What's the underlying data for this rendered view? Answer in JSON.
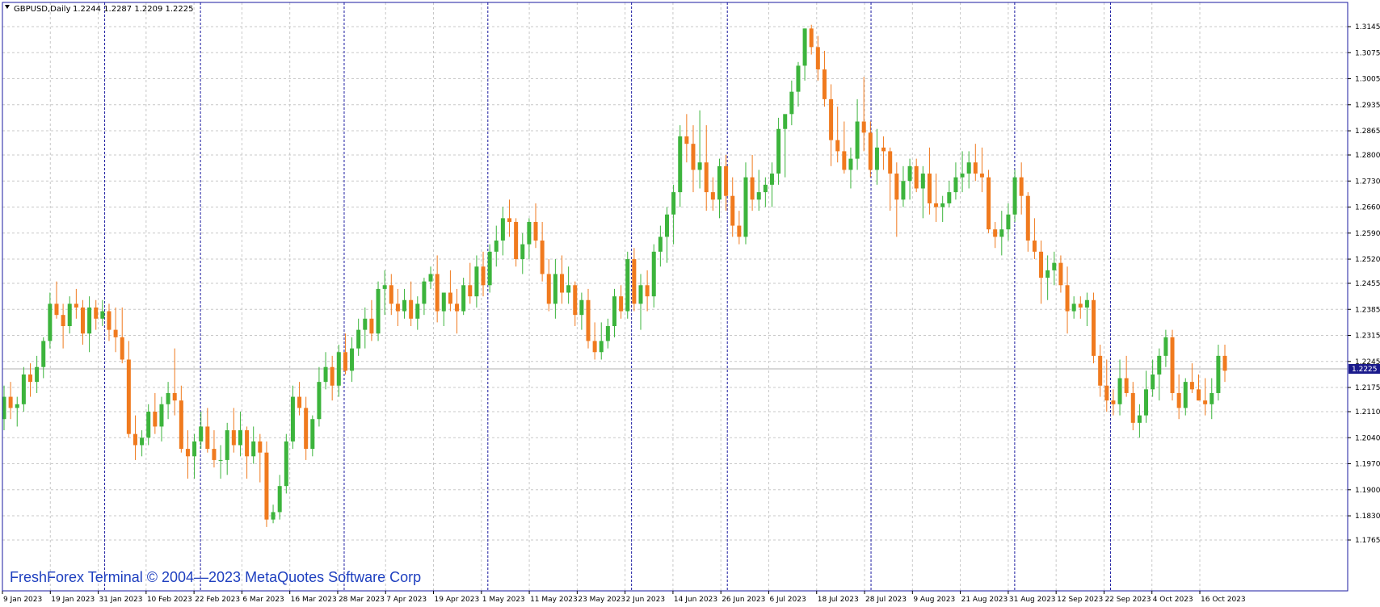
{
  "header": {
    "title": "GBPUSD,Daily",
    "ohlc": "1.2244 1.2287 1.2209 1.2225"
  },
  "watermark": "FreshForex Terminal © 2004—2023 MetaQuotes Software Corp",
  "colors": {
    "bull": "#3cb43c",
    "bear": "#f07a1e",
    "frame": "#1a1aa0",
    "grid": "#c8c8c8",
    "period_sep": "#1a1aa0",
    "current_price_bg": "#1a1a8c"
  },
  "current_price": "1.2225",
  "chart_data": {
    "type": "candlestick",
    "title": "GBPUSD,Daily",
    "ylim": [
      1.1765,
      1.3145
    ],
    "y_ticks": [
      "1.3145",
      "1.3075",
      "1.3005",
      "1.2935",
      "1.2865",
      "1.2800",
      "1.2730",
      "1.2660",
      "1.2590",
      "1.2520",
      "1.2455",
      "1.2385",
      "1.2315",
      "1.2245",
      "1.2175",
      "1.2110",
      "1.2040",
      "1.1970",
      "1.1900",
      "1.1830",
      "1.1765"
    ],
    "x_labels": [
      "9 Jan 2023",
      "19 Jan 2023",
      "31 Jan 2023",
      "10 Feb 2023",
      "22 Feb 2023",
      "6 Mar 2023",
      "16 Mar 2023",
      "28 Mar 2023",
      "7 Apr 2023",
      "19 Apr 2023",
      "1 May 2023",
      "11 May 2023",
      "23 May 2023",
      "2 Jun 2023",
      "14 Jun 2023",
      "26 Jun 2023",
      "6 Jul 2023",
      "18 Jul 2023",
      "28 Jul 2023",
      "9 Aug 2023",
      "21 Aug 2023",
      "31 Aug 2023",
      "12 Sep 2023",
      "22 Sep 2023",
      "4 Oct 2023",
      "16 Oct 2023"
    ],
    "grid": true,
    "candles": [
      [
        1.209,
        1.218,
        1.206,
        1.215
      ],
      [
        1.215,
        1.219,
        1.209,
        1.212
      ],
      [
        1.212,
        1.215,
        1.207,
        1.213
      ],
      [
        1.213,
        1.223,
        1.211,
        1.221
      ],
      [
        1.221,
        1.224,
        1.215,
        1.219
      ],
      [
        1.219,
        1.226,
        1.216,
        1.223
      ],
      [
        1.223,
        1.231,
        1.22,
        1.23
      ],
      [
        1.23,
        1.243,
        1.228,
        1.24
      ],
      [
        1.24,
        1.246,
        1.236,
        1.237
      ],
      [
        1.237,
        1.24,
        1.228,
        1.234
      ],
      [
        1.234,
        1.242,
        1.232,
        1.24
      ],
      [
        1.24,
        1.244,
        1.236,
        1.239
      ],
      [
        1.239,
        1.241,
        1.229,
        1.232
      ],
      [
        1.232,
        1.242,
        1.227,
        1.239
      ],
      [
        1.239,
        1.241,
        1.233,
        1.236
      ],
      [
        1.236,
        1.241,
        1.234,
        1.238
      ],
      [
        1.238,
        1.24,
        1.23,
        1.233
      ],
      [
        1.233,
        1.239,
        1.227,
        1.231
      ],
      [
        1.231,
        1.239,
        1.224,
        1.225
      ],
      [
        1.225,
        1.23,
        1.204,
        1.205
      ],
      [
        1.205,
        1.21,
        1.198,
        1.202
      ],
      [
        1.202,
        1.206,
        1.199,
        1.204
      ],
      [
        1.204,
        1.213,
        1.202,
        1.211
      ],
      [
        1.211,
        1.216,
        1.205,
        1.207
      ],
      [
        1.207,
        1.215,
        1.203,
        1.213
      ],
      [
        1.213,
        1.219,
        1.209,
        1.216
      ],
      [
        1.216,
        1.228,
        1.21,
        1.214
      ],
      [
        1.214,
        1.218,
        1.2,
        1.201
      ],
      [
        1.201,
        1.206,
        1.193,
        1.199
      ],
      [
        1.199,
        1.205,
        1.193,
        1.203
      ],
      [
        1.203,
        1.211,
        1.201,
        1.207
      ],
      [
        1.207,
        1.212,
        1.2,
        1.201
      ],
      [
        1.201,
        1.206,
        1.196,
        1.198
      ],
      [
        1.198,
        1.202,
        1.193,
        1.198
      ],
      [
        1.198,
        1.208,
        1.194,
        1.206
      ],
      [
        1.206,
        1.212,
        1.2,
        1.202
      ],
      [
        1.202,
        1.211,
        1.199,
        1.206
      ],
      [
        1.206,
        1.207,
        1.193,
        1.199
      ],
      [
        1.199,
        1.207,
        1.197,
        1.203
      ],
      [
        1.203,
        1.205,
        1.192,
        1.2
      ],
      [
        1.2,
        1.203,
        1.18,
        1.182
      ],
      [
        1.182,
        1.186,
        1.181,
        1.184
      ],
      [
        1.184,
        1.194,
        1.182,
        1.191
      ],
      [
        1.191,
        1.205,
        1.189,
        1.203
      ],
      [
        1.203,
        1.218,
        1.201,
        1.215
      ],
      [
        1.215,
        1.219,
        1.21,
        1.212
      ],
      [
        1.212,
        1.215,
        1.198,
        1.201
      ],
      [
        1.201,
        1.21,
        1.199,
        1.209
      ],
      [
        1.209,
        1.223,
        1.207,
        1.219
      ],
      [
        1.219,
        1.227,
        1.217,
        1.223
      ],
      [
        1.223,
        1.226,
        1.214,
        1.218
      ],
      [
        1.218,
        1.229,
        1.215,
        1.227
      ],
      [
        1.227,
        1.232,
        1.221,
        1.222
      ],
      [
        1.222,
        1.231,
        1.219,
        1.228
      ],
      [
        1.228,
        1.236,
        1.226,
        1.233
      ],
      [
        1.233,
        1.239,
        1.228,
        1.236
      ],
      [
        1.236,
        1.241,
        1.23,
        1.232
      ],
      [
        1.232,
        1.246,
        1.23,
        1.244
      ],
      [
        1.244,
        1.249,
        1.237,
        1.245
      ],
      [
        1.245,
        1.248,
        1.237,
        1.24
      ],
      [
        1.24,
        1.244,
        1.234,
        1.238
      ],
      [
        1.238,
        1.244,
        1.236,
        1.241
      ],
      [
        1.241,
        1.246,
        1.234,
        1.236
      ],
      [
        1.236,
        1.242,
        1.233,
        1.24
      ],
      [
        1.24,
        1.247,
        1.237,
        1.246
      ],
      [
        1.246,
        1.25,
        1.244,
        1.248
      ],
      [
        1.248,
        1.253,
        1.235,
        1.238
      ],
      [
        1.238,
        1.243,
        1.234,
        1.243
      ],
      [
        1.243,
        1.249,
        1.238,
        1.24
      ],
      [
        1.24,
        1.244,
        1.232,
        1.238
      ],
      [
        1.238,
        1.247,
        1.237,
        1.245
      ],
      [
        1.245,
        1.251,
        1.24,
        1.242
      ],
      [
        1.242,
        1.253,
        1.239,
        1.25
      ],
      [
        1.25,
        1.254,
        1.242,
        1.245
      ],
      [
        1.245,
        1.256,
        1.243,
        1.254
      ],
      [
        1.254,
        1.261,
        1.25,
        1.257
      ],
      [
        1.257,
        1.266,
        1.253,
        1.263
      ],
      [
        1.263,
        1.268,
        1.258,
        1.262
      ],
      [
        1.262,
        1.263,
        1.25,
        1.252
      ],
      [
        1.252,
        1.259,
        1.248,
        1.256
      ],
      [
        1.256,
        1.263,
        1.252,
        1.262
      ],
      [
        1.262,
        1.267,
        1.255,
        1.257
      ],
      [
        1.257,
        1.262,
        1.246,
        1.248
      ],
      [
        1.248,
        1.252,
        1.238,
        1.24
      ],
      [
        1.24,
        1.252,
        1.236,
        1.248
      ],
      [
        1.248,
        1.253,
        1.24,
        1.243
      ],
      [
        1.243,
        1.25,
        1.24,
        1.245
      ],
      [
        1.245,
        1.246,
        1.234,
        1.237
      ],
      [
        1.237,
        1.243,
        1.233,
        1.241
      ],
      [
        1.241,
        1.244,
        1.228,
        1.23
      ],
      [
        1.23,
        1.235,
        1.225,
        1.227
      ],
      [
        1.227,
        1.235,
        1.225,
        1.23
      ],
      [
        1.23,
        1.236,
        1.228,
        1.234
      ],
      [
        1.234,
        1.244,
        1.231,
        1.242
      ],
      [
        1.242,
        1.245,
        1.236,
        1.238
      ],
      [
        1.238,
        1.254,
        1.236,
        1.252
      ],
      [
        1.252,
        1.255,
        1.238,
        1.24
      ],
      [
        1.24,
        1.248,
        1.233,
        1.245
      ],
      [
        1.245,
        1.249,
        1.238,
        1.242
      ],
      [
        1.242,
        1.256,
        1.239,
        1.254
      ],
      [
        1.254,
        1.261,
        1.25,
        1.258
      ],
      [
        1.258,
        1.266,
        1.251,
        1.264
      ],
      [
        1.264,
        1.272,
        1.256,
        1.27
      ],
      [
        1.27,
        1.288,
        1.266,
        1.285
      ],
      [
        1.285,
        1.291,
        1.278,
        1.283
      ],
      [
        1.283,
        1.288,
        1.27,
        1.276
      ],
      [
        1.276,
        1.292,
        1.271,
        1.278
      ],
      [
        1.278,
        1.288,
        1.265,
        1.27
      ],
      [
        1.27,
        1.274,
        1.265,
        1.268
      ],
      [
        1.268,
        1.279,
        1.263,
        1.277
      ],
      [
        1.277,
        1.28,
        1.265,
        1.269
      ],
      [
        1.269,
        1.274,
        1.258,
        1.261
      ],
      [
        1.261,
        1.265,
        1.256,
        1.258
      ],
      [
        1.258,
        1.278,
        1.256,
        1.274
      ],
      [
        1.274,
        1.28,
        1.265,
        1.268
      ],
      [
        1.268,
        1.276,
        1.265,
        1.27
      ],
      [
        1.27,
        1.274,
        1.266,
        1.272
      ],
      [
        1.272,
        1.278,
        1.266,
        1.275
      ],
      [
        1.275,
        1.29,
        1.272,
        1.287
      ],
      [
        1.287,
        1.29,
        1.274,
        1.291
      ],
      [
        1.291,
        1.3,
        1.288,
        1.297
      ],
      [
        1.297,
        1.305,
        1.293,
        1.304
      ],
      [
        1.304,
        1.314,
        1.3,
        1.314
      ],
      [
        1.314,
        1.315,
        1.307,
        1.309
      ],
      [
        1.309,
        1.312,
        1.3,
        1.303
      ],
      [
        1.303,
        1.308,
        1.293,
        1.295
      ],
      [
        1.295,
        1.299,
        1.277,
        1.284
      ],
      [
        1.284,
        1.293,
        1.278,
        1.281
      ],
      [
        1.281,
        1.289,
        1.275,
        1.276
      ],
      [
        1.276,
        1.282,
        1.271,
        1.279
      ],
      [
        1.279,
        1.295,
        1.276,
        1.289
      ],
      [
        1.289,
        1.301,
        1.281,
        1.286
      ],
      [
        1.286,
        1.289,
        1.274,
        1.276
      ],
      [
        1.276,
        1.287,
        1.272,
        1.282
      ],
      [
        1.282,
        1.285,
        1.276,
        1.281
      ],
      [
        1.281,
        1.282,
        1.265,
        1.275
      ],
      [
        1.275,
        1.278,
        1.258,
        1.268
      ],
      [
        1.268,
        1.277,
        1.266,
        1.273
      ],
      [
        1.273,
        1.279,
        1.268,
        1.277
      ],
      [
        1.277,
        1.279,
        1.27,
        1.271
      ],
      [
        1.271,
        1.277,
        1.263,
        1.275
      ],
      [
        1.275,
        1.282,
        1.264,
        1.267
      ],
      [
        1.267,
        1.275,
        1.262,
        1.266
      ],
      [
        1.266,
        1.269,
        1.262,
        1.267
      ],
      [
        1.267,
        1.273,
        1.266,
        1.27
      ],
      [
        1.27,
        1.278,
        1.268,
        1.274
      ],
      [
        1.274,
        1.281,
        1.27,
        1.275
      ],
      [
        1.275,
        1.281,
        1.271,
        1.278
      ],
      [
        1.278,
        1.283,
        1.273,
        1.275
      ],
      [
        1.275,
        1.282,
        1.27,
        1.274
      ],
      [
        1.274,
        1.276,
        1.259,
        1.26
      ],
      [
        1.26,
        1.262,
        1.255,
        1.258
      ],
      [
        1.258,
        1.265,
        1.253,
        1.26
      ],
      [
        1.26,
        1.267,
        1.257,
        1.264
      ],
      [
        1.264,
        1.276,
        1.262,
        1.274
      ],
      [
        1.274,
        1.278,
        1.264,
        1.269
      ],
      [
        1.269,
        1.27,
        1.254,
        1.257
      ],
      [
        1.257,
        1.263,
        1.252,
        1.254
      ],
      [
        1.254,
        1.257,
        1.24,
        1.247
      ],
      [
        1.247,
        1.253,
        1.241,
        1.249
      ],
      [
        1.249,
        1.254,
        1.245,
        1.251
      ],
      [
        1.251,
        1.253,
        1.243,
        1.245
      ],
      [
        1.245,
        1.25,
        1.232,
        1.238
      ],
      [
        1.238,
        1.242,
        1.236,
        1.24
      ],
      [
        1.24,
        1.242,
        1.236,
        1.239
      ],
      [
        1.239,
        1.243,
        1.234,
        1.241
      ],
      [
        1.241,
        1.243,
        1.224,
        1.226
      ],
      [
        1.226,
        1.229,
        1.215,
        1.218
      ],
      [
        1.218,
        1.225,
        1.211,
        1.214
      ],
      [
        1.214,
        1.217,
        1.21,
        1.213
      ],
      [
        1.213,
        1.225,
        1.21,
        1.22
      ],
      [
        1.22,
        1.226,
        1.215,
        1.216
      ],
      [
        1.216,
        1.219,
        1.206,
        1.208
      ],
      [
        1.208,
        1.213,
        1.204,
        1.21
      ],
      [
        1.21,
        1.222,
        1.208,
        1.217
      ],
      [
        1.217,
        1.225,
        1.215,
        1.221
      ],
      [
        1.221,
        1.228,
        1.214,
        1.226
      ],
      [
        1.226,
        1.233,
        1.223,
        1.231
      ],
      [
        1.231,
        1.233,
        1.214,
        1.216
      ],
      [
        1.216,
        1.221,
        1.209,
        1.212
      ],
      [
        1.212,
        1.22,
        1.21,
        1.219
      ],
      [
        1.219,
        1.224,
        1.216,
        1.217
      ],
      [
        1.217,
        1.221,
        1.214,
        1.214
      ],
      [
        1.214,
        1.22,
        1.21,
        1.213
      ],
      [
        1.213,
        1.22,
        1.209,
        1.216
      ],
      [
        1.216,
        1.229,
        1.214,
        1.226
      ],
      [
        1.226,
        1.229,
        1.219,
        1.222
      ]
    ]
  }
}
